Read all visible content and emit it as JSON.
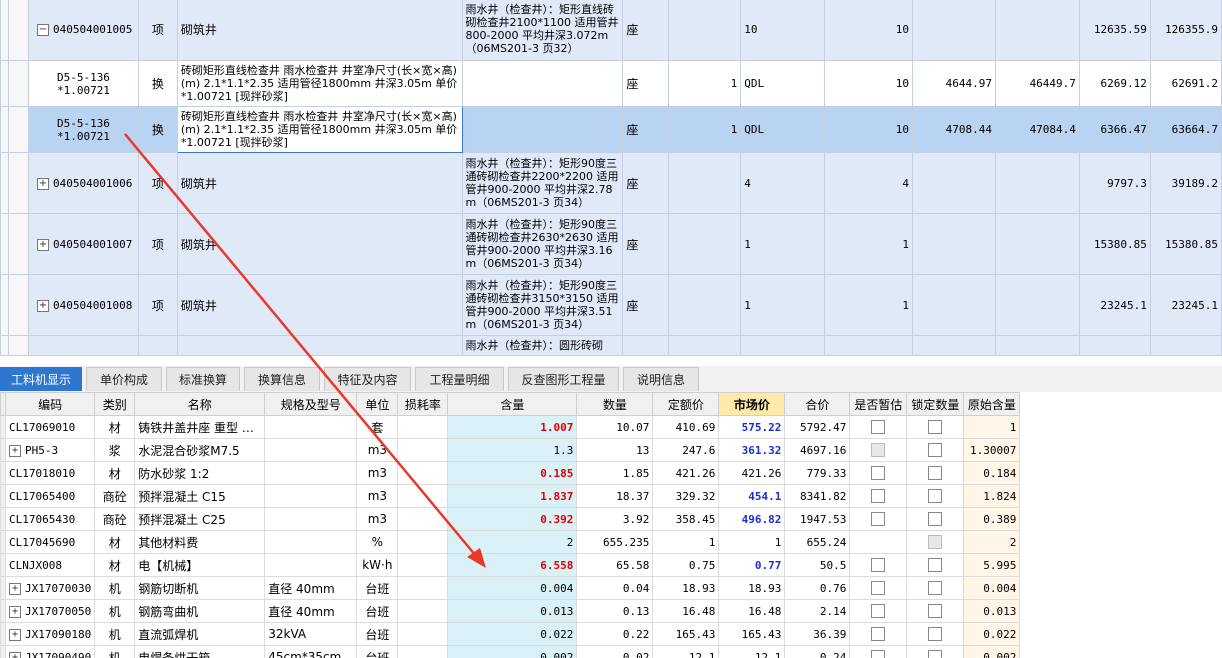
{
  "top_rows": [
    {
      "code": "040504001005",
      "type": "项",
      "name": "砌筑井",
      "desc": "雨水井（检查井）：矩形直线砖砌检查井2100*1100 适用管井800-2000 平均井深3.072m（06MS201-3 页32）",
      "unit": "座",
      "c1": "",
      "c2": "10",
      "c3": "10",
      "c4": "",
      "c5": "",
      "c6": "12635.59",
      "c7": "126355.9",
      "expander": "−",
      "style": "blue"
    },
    {
      "code": "D5-5-136\n*1.00721",
      "type": "换",
      "name": "砖砌矩形直线检查井 雨水检查井 井室净尺寸(长×宽×高)(m) 2.1*1.1*2.35 适用管径1800mm 井深3.05m 单价*1.00721 [现拌砂浆]",
      "desc": "",
      "unit": "座",
      "c1": "1",
      "c2": "QDL",
      "c3": "10",
      "c4": "4644.97",
      "c5": "46449.7",
      "c6": "6269.12",
      "c7": "62691.2",
      "expander": "",
      "style": "white"
    },
    {
      "code": "D5-5-136\n*1.00721",
      "type": "换",
      "name": "砖砌矩形直线检查井 雨水检查井 井室净尺寸(长×宽×高)(m) 2.1*1.1*2.35 适用管径1800mm 井深3.05m 单价*1.00721 [现拌砂浆]",
      "desc": "",
      "unit": "座",
      "c1": "1",
      "c2": "QDL",
      "c3": "10",
      "c4": "4708.44",
      "c5": "47084.4",
      "c6": "6366.47",
      "c7": "63664.7",
      "expander": "",
      "style": "sel"
    },
    {
      "code": "040504001006",
      "type": "项",
      "name": "砌筑井",
      "desc": "雨水井（检查井）：矩形90度三通砖砌检查井2200*2200 适用管井900-2000 平均井深2.78m（06MS201-3 页34）",
      "unit": "座",
      "c1": "",
      "c2": "4",
      "c3": "4",
      "c4": "",
      "c5": "",
      "c6": "9797.3",
      "c7": "39189.2",
      "expander": "+",
      "style": "blue"
    },
    {
      "code": "040504001007",
      "type": "项",
      "name": "砌筑井",
      "desc": "雨水井（检查井）：矩形90度三通砖砌检查井2630*2630 适用管井900-2000 平均井深3.16m（06MS201-3 页34）",
      "unit": "座",
      "c1": "",
      "c2": "1",
      "c3": "1",
      "c4": "",
      "c5": "",
      "c6": "15380.85",
      "c7": "15380.85",
      "expander": "+",
      "style": "blue"
    },
    {
      "code": "040504001008",
      "type": "项",
      "name": "砌筑井",
      "desc": "雨水井（检查井）：矩形90度三通砖砌检查井3150*3150 适用管井900-2000 平均井深3.51m（06MS201-3 页34）",
      "unit": "座",
      "c1": "",
      "c2": "1",
      "c3": "1",
      "c4": "",
      "c5": "",
      "c6": "23245.1",
      "c7": "23245.1",
      "expander": "+",
      "style": "blue"
    },
    {
      "code": "",
      "type": "",
      "name": "",
      "desc": "雨水井（检查井）：圆形砖砌",
      "unit": "",
      "c1": "",
      "c2": "",
      "c3": "",
      "c4": "",
      "c5": "",
      "c6": "",
      "c7": "",
      "expander": "",
      "style": "blue"
    }
  ],
  "tabs": [
    "工料机显示",
    "单价构成",
    "标准换算",
    "换算信息",
    "特征及内容",
    "工程量明细",
    "反查图形工程量",
    "说明信息"
  ],
  "bottom_headers": [
    "编码",
    "类别",
    "名称",
    "规格及型号",
    "单位",
    "损耗率",
    "含量",
    "数量",
    "定额价",
    "市场价",
    "合价",
    "是否暂估",
    "锁定数量",
    "原始含量"
  ],
  "bottom_rows": [
    {
      "code": "CL17069010",
      "cat": "材",
      "name": "铸铁井盖井座 重型 …",
      "spec": "",
      "unit": "套",
      "loss": "",
      "qty": "1.007",
      "qty_red": true,
      "amount": "10.07",
      "quota": "410.69",
      "market": "575.22",
      "market_blue": true,
      "total": "5792.47",
      "temp": "box",
      "lock": "box",
      "orig": "1",
      "exp": false
    },
    {
      "code": "PH5-3",
      "cat": "浆",
      "name": "水泥混合砂浆M7.5",
      "spec": "",
      "unit": "m3",
      "loss": "",
      "qty": "1.3",
      "qty_red": false,
      "amount": "13",
      "quota": "247.6",
      "market": "361.32",
      "market_blue": true,
      "total": "4697.16",
      "temp": "dis",
      "lock": "box",
      "orig": "1.30007",
      "exp": true
    },
    {
      "code": "CL17018010",
      "cat": "材",
      "name": "防水砂浆 1:2",
      "spec": "",
      "unit": "m3",
      "loss": "",
      "qty": "0.185",
      "qty_red": true,
      "amount": "1.85",
      "quota": "421.26",
      "market": "421.26",
      "market_blue": false,
      "total": "779.33",
      "temp": "box",
      "lock": "box",
      "orig": "0.184",
      "exp": false
    },
    {
      "code": "CL17065400",
      "cat": "商砼",
      "name": "预拌混凝土 C15",
      "spec": "",
      "unit": "m3",
      "loss": "",
      "qty": "1.837",
      "qty_red": true,
      "amount": "18.37",
      "quota": "329.32",
      "market": "454.1",
      "market_blue": true,
      "total": "8341.82",
      "temp": "box",
      "lock": "box",
      "orig": "1.824",
      "exp": false
    },
    {
      "code": "CL17065430",
      "cat": "商砼",
      "name": "预拌混凝土 C25",
      "spec": "",
      "unit": "m3",
      "loss": "",
      "qty": "0.392",
      "qty_red": true,
      "amount": "3.92",
      "quota": "358.45",
      "market": "496.82",
      "market_blue": true,
      "total": "1947.53",
      "temp": "box",
      "lock": "box",
      "orig": "0.389",
      "exp": false
    },
    {
      "code": "CL17045690",
      "cat": "材",
      "name": "其他材料费",
      "spec": "",
      "unit": "%",
      "loss": "",
      "qty": "2",
      "qty_red": false,
      "amount": "655.235",
      "quota": "1",
      "market": "1",
      "market_blue": false,
      "total": "655.24",
      "temp": "none",
      "lock": "dis",
      "orig": "2",
      "exp": false
    },
    {
      "code": "CLNJX008",
      "cat": "材",
      "name": "电【机械】",
      "spec": "",
      "unit": "kW·h",
      "loss": "",
      "qty": "6.558",
      "qty_red": true,
      "amount": "65.58",
      "quota": "0.75",
      "market": "0.77",
      "market_blue": true,
      "total": "50.5",
      "temp": "box",
      "lock": "box",
      "orig": "5.995",
      "exp": false
    },
    {
      "code": "JX17070030",
      "cat": "机",
      "name": "钢筋切断机",
      "spec": "直径 40mm",
      "unit": "台班",
      "loss": "",
      "qty": "0.004",
      "qty_red": false,
      "amount": "0.04",
      "quota": "18.93",
      "market": "18.93",
      "market_blue": false,
      "total": "0.76",
      "temp": "box",
      "lock": "box",
      "orig": "0.004",
      "exp": true
    },
    {
      "code": "JX17070050",
      "cat": "机",
      "name": "钢筋弯曲机",
      "spec": "直径 40mm",
      "unit": "台班",
      "loss": "",
      "qty": "0.013",
      "qty_red": false,
      "amount": "0.13",
      "quota": "16.48",
      "market": "16.48",
      "market_blue": false,
      "total": "2.14",
      "temp": "box",
      "lock": "box",
      "orig": "0.013",
      "exp": true
    },
    {
      "code": "JX17090180",
      "cat": "机",
      "name": "直流弧焊机",
      "spec": "32kVA",
      "unit": "台班",
      "loss": "",
      "qty": "0.022",
      "qty_red": false,
      "amount": "0.22",
      "quota": "165.43",
      "market": "165.43",
      "market_blue": false,
      "total": "36.39",
      "temp": "box",
      "lock": "box",
      "orig": "0.022",
      "exp": true
    },
    {
      "code": "JX17090490",
      "cat": "机",
      "name": "电焊条烘干箱",
      "spec": "45cm*35cm…",
      "unit": "台班",
      "loss": "",
      "qty": "0.002",
      "qty_red": false,
      "amount": "0.02",
      "quota": "12.1",
      "market": "12.1",
      "market_blue": false,
      "total": "0.24",
      "temp": "box",
      "lock": "box",
      "orig": "0.002",
      "exp": true
    }
  ],
  "colors": {
    "accent": "#2e77d0",
    "arrow": "#e8392a",
    "qty_red": "#e00000",
    "market_blue": "#1a2fd0"
  }
}
